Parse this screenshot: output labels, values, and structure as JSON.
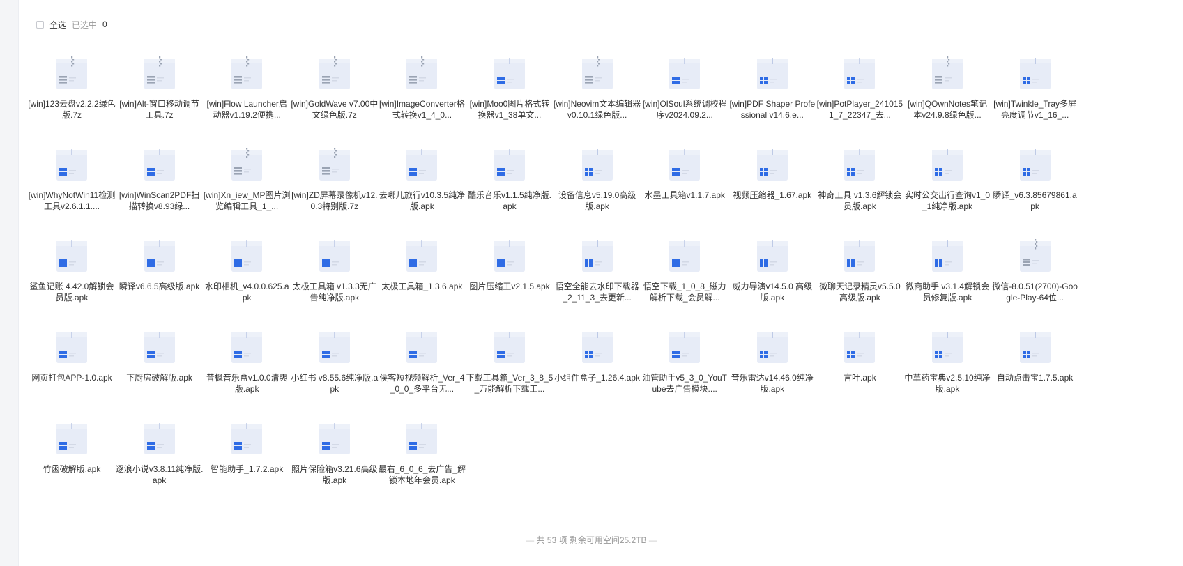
{
  "toolbar": {
    "select_all_label": "全选",
    "selected_label": "已选中",
    "selected_count": "0"
  },
  "files": [
    {
      "name": "[win]123云盘v2.2.2绿色版.7z",
      "type": "archive"
    },
    {
      "name": "[win]Alt-窗口移动调节工具.7z",
      "type": "archive"
    },
    {
      "name": "[win]Flow Launcher启动器v1.19.2便携...",
      "type": "archive"
    },
    {
      "name": "[win]GoldWave v7.00中文绿色版.7z",
      "type": "archive"
    },
    {
      "name": "[win]ImageConverter格式转换v1_4_0...",
      "type": "archive"
    },
    {
      "name": "[win]Moo0图片格式转换器v1_38单文...",
      "type": "windows"
    },
    {
      "name": "[win]Neovim文本编辑器v0.10.1绿色版...",
      "type": "archive"
    },
    {
      "name": "[win]OlSoul系统调校程序v2024.09.2...",
      "type": "windows"
    },
    {
      "name": "[win]PDF Shaper Professional v14.6.e...",
      "type": "windows"
    },
    {
      "name": "[win]PotPlayer_2410151_7_22347_去...",
      "type": "windows"
    },
    {
      "name": "[win]QOwnNotes笔记本v24.9.8绿色版...",
      "type": "archive"
    },
    {
      "name": "[win]Twinkle_Tray多屏亮度调节v1_16_...",
      "type": "windows"
    },
    {
      "name": "[win]WhyNotWin11检测工具v2.6.1.1....",
      "type": "windows"
    },
    {
      "name": "[win]WinScan2PDF扫描转换v8.93绿...",
      "type": "windows"
    },
    {
      "name": "[win]Xn_iew_MP图片浏览编辑工具_1_...",
      "type": "archive"
    },
    {
      "name": "[win]ZD屏幕录像机v12.0.3特别版.7z",
      "type": "archive"
    },
    {
      "name": "去哪儿旅行v10.3.5纯净版.apk",
      "type": "windows"
    },
    {
      "name": "酷乐音乐v1.1.5纯净版.apk",
      "type": "windows"
    },
    {
      "name": "设备信息v5.19.0高级版.apk",
      "type": "windows"
    },
    {
      "name": "水墨工具箱v1.1.7.apk",
      "type": "windows"
    },
    {
      "name": "视频压缩器_1.67.apk",
      "type": "windows"
    },
    {
      "name": "神奇工具 v1.3.6解锁会员版.apk",
      "type": "windows"
    },
    {
      "name": "实时公交出行查询v1_0_1纯净版.apk",
      "type": "windows"
    },
    {
      "name": "瞬译_v6.3.85679861.apk",
      "type": "windows"
    },
    {
      "name": "鲨鱼记账 4.42.0解锁会员版.apk",
      "type": "windows"
    },
    {
      "name": "瞬译v6.6.5高级版.apk",
      "type": "windows"
    },
    {
      "name": "水印相机_v4.0.0.625.apk",
      "type": "windows"
    },
    {
      "name": "太极工具箱 v1.3.3无广告纯净版.apk",
      "type": "windows"
    },
    {
      "name": "太极工具箱_1.3.6.apk",
      "type": "windows"
    },
    {
      "name": "图片压缩王v2.1.5.apk",
      "type": "windows"
    },
    {
      "name": "悟空全能去水印下载器_2_11_3_去更新...",
      "type": "windows"
    },
    {
      "name": "悟空下载_1_0_8_磁力解析下载_会员解...",
      "type": "windows"
    },
    {
      "name": "威力导演v14.5.0 高级版.apk",
      "type": "windows"
    },
    {
      "name": "微聊天记录精灵v5.5.0高级版.apk",
      "type": "windows"
    },
    {
      "name": "微商助手 v3.1.4解锁会员修复版.apk",
      "type": "windows"
    },
    {
      "name": "微信-8.0.51(2700)-Google-Play-64位...",
      "type": "archive"
    },
    {
      "name": "网页打包APP-1.0.apk",
      "type": "windows"
    },
    {
      "name": "下厨房破解版.apk",
      "type": "windows"
    },
    {
      "name": "昔枫音乐盒v1.0.0清爽版.apk",
      "type": "windows"
    },
    {
      "name": "小红书 v8.55.6纯净版.apk",
      "type": "windows"
    },
    {
      "name": "侯客短视频解析_Ver_4_0_0_多平台无...",
      "type": "windows"
    },
    {
      "name": "下载工具箱_Ver_3_8_5_万能解析下载工...",
      "type": "windows"
    },
    {
      "name": "小组件盒子_1.26.4.apk",
      "type": "windows"
    },
    {
      "name": "油管助手v5_3_0_YouTube去广告模块....",
      "type": "windows"
    },
    {
      "name": "音乐雷达v14.46.0纯净版.apk",
      "type": "windows"
    },
    {
      "name": "言叶.apk",
      "type": "windows"
    },
    {
      "name": "中草药宝典v2.5.10纯净版.apk",
      "type": "windows"
    },
    {
      "name": "自动点击宝1.7.5.apk",
      "type": "windows"
    },
    {
      "name": "竹函破解版.apk",
      "type": "windows"
    },
    {
      "name": "逐浪小说v3.8.11纯净版.apk",
      "type": "windows"
    },
    {
      "name": "智能助手_1.7.2.apk",
      "type": "windows"
    },
    {
      "name": "照片保险箱v3.21.6高级版.apk",
      "type": "windows"
    },
    {
      "name": "最右_6_0_6_去广告_解锁本地年会员.apk",
      "type": "windows"
    }
  ],
  "footer": {
    "text": "共 53 项 剩余可用空间25.2TB"
  },
  "colors": {
    "icon_body": "#e7ecf7",
    "icon_blue": "#2f6ce5",
    "icon_gray": "#9aa3b3"
  }
}
